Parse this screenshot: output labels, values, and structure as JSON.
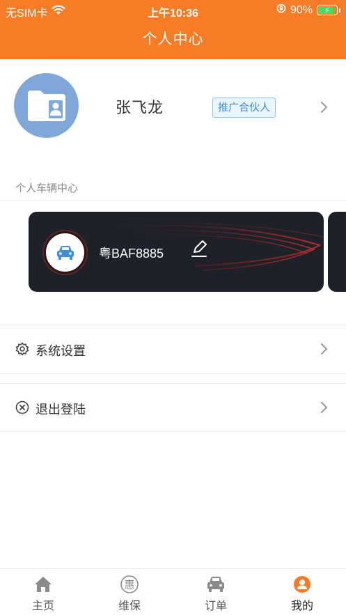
{
  "status_bar": {
    "carrier": "无SIM卡",
    "time": "上午10:36",
    "battery_percent": "90%"
  },
  "header": {
    "title": "个人中心"
  },
  "profile": {
    "name": "张飞龙",
    "badge": "推广合伙人"
  },
  "vehicles": {
    "section_label": "个人车辆中心",
    "items": [
      {
        "plate": "粤BAF8885"
      }
    ]
  },
  "menu": {
    "settings_label": "系统设置",
    "logout_label": "退出登陆"
  },
  "tabbar": {
    "items": [
      {
        "label": "主页",
        "icon": "home-icon"
      },
      {
        "label": "维保",
        "icon": "hui-icon",
        "glyph": "惠"
      },
      {
        "label": "订单",
        "icon": "car-icon"
      },
      {
        "label": "我的",
        "icon": "user-icon"
      }
    ],
    "active_index": 3
  },
  "colors": {
    "header": "#f87c26",
    "active_tab": "#f87c26",
    "badge_text": "#3f8fd6",
    "avatar_bg": "#7fa8d8",
    "vehicle_card": "#1f2128"
  }
}
